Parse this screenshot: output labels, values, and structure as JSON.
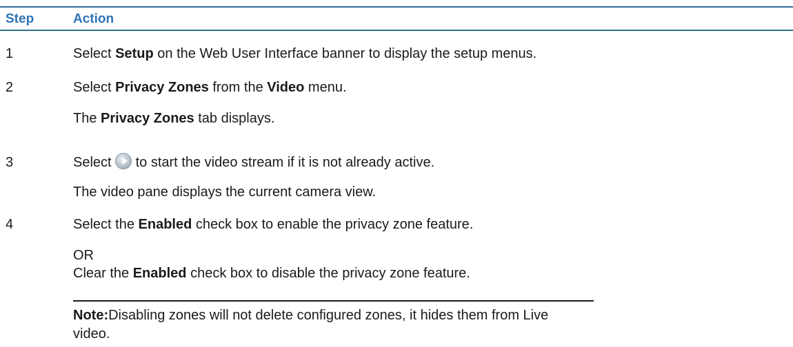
{
  "header": {
    "step": "Step",
    "action": "Action"
  },
  "steps": [
    {
      "number": "1",
      "line1": {
        "pre": "Select ",
        "b1": "Setup",
        "post": " on the Web User Interface banner to display the setup menus."
      }
    },
    {
      "number": "2",
      "line1": {
        "pre": "Select ",
        "b1": "Privacy Zones",
        "mid": " from the ",
        "b2": "Video",
        "post": " menu."
      },
      "line2": {
        "pre": "The ",
        "b1": "Privacy Zones",
        "post": " tab displays."
      }
    },
    {
      "number": "3",
      "line1": {
        "pre": "Select",
        "icon": "play-icon",
        "post": "to start the video stream if it is not already active."
      },
      "line2": {
        "text": "The video pane displays the current camera view."
      }
    },
    {
      "number": "4",
      "line1": {
        "pre": "Select the ",
        "b1": "Enabled",
        "post": " check box to enable the privacy zone feature."
      },
      "or": "OR",
      "line2": {
        "pre": "Clear the ",
        "b1": "Enabled",
        "post": " check box to disable the privacy zone feature."
      }
    }
  ],
  "note": {
    "label": "Note:",
    "text": "Disabling zones will not delete configured zones, it hides them from Live video."
  }
}
